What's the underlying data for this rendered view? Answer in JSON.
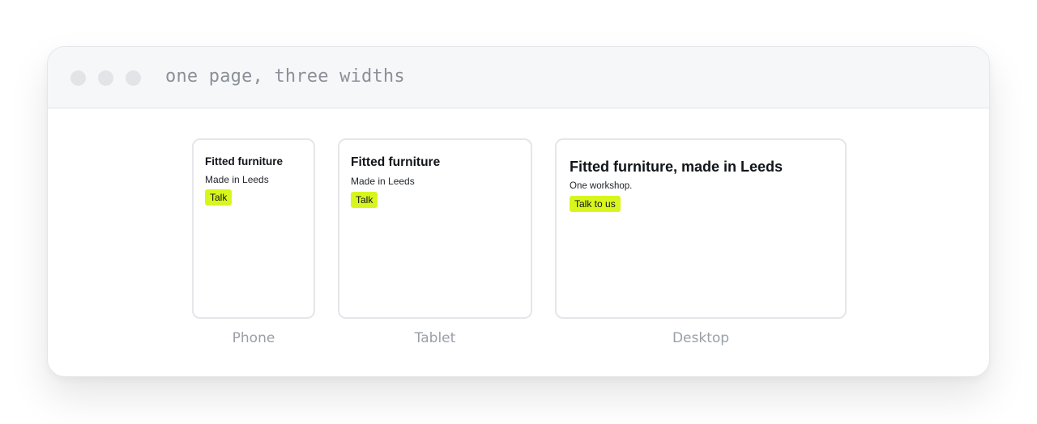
{
  "window": {
    "title": "one page, three widths"
  },
  "previews": {
    "phone": {
      "heading": "Fitted furniture",
      "subtext": "Made in Leeds",
      "cta": "Talk",
      "label": "Phone"
    },
    "tablet": {
      "heading": "Fitted furniture",
      "subtext": "Made in Leeds",
      "cta": "Talk",
      "label": "Tablet"
    },
    "desktop": {
      "heading": "Fitted furniture, made in Leeds",
      "subtext": "One workshop.",
      "cta": "Talk to us",
      "label": "Desktop"
    }
  },
  "colors": {
    "accent": "#d8f61d",
    "titlebar": "#f6f7f9",
    "caption": "#9aa0a8"
  }
}
